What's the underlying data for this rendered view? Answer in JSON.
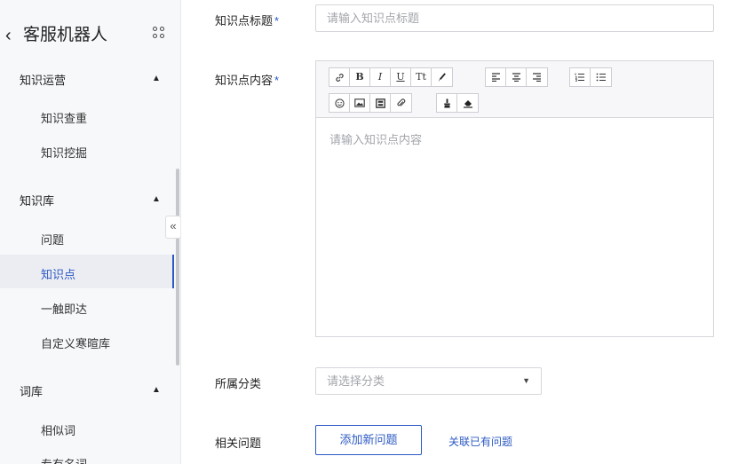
{
  "sidebar": {
    "title": "客服机器人",
    "sections": [
      {
        "label": "知识运营",
        "items": [
          "知识查重",
          "知识挖掘"
        ]
      },
      {
        "label": "知识库",
        "items": [
          "问题",
          "知识点",
          "一触即达",
          "自定义寒暄库"
        ]
      },
      {
        "label": "词库",
        "items": [
          "相似词",
          "专有名词"
        ]
      }
    ],
    "active_item": "知识点",
    "collapse_glyph": "«"
  },
  "form": {
    "title_label": "知识点标题",
    "title_placeholder": "请输入知识点标题",
    "content_label": "知识点内容",
    "content_placeholder": "请输入知识点内容",
    "required_mark": "*",
    "category_label": "所属分类",
    "category_placeholder": "请选择分类",
    "related_label": "相关问题",
    "add_question_button": "添加新问题",
    "link_existing": "关联已有问题"
  },
  "toolbar": {
    "bold": "B",
    "italic": "I",
    "underline": "U",
    "font_size": "Tt"
  },
  "icons": [
    "back-icon",
    "apps-icon",
    "link-icon",
    "bold-icon",
    "italic-icon",
    "underline-icon",
    "font-size-icon",
    "brush-icon",
    "align-left-icon",
    "align-center-icon",
    "align-right-icon",
    "ordered-list-icon",
    "unordered-list-icon",
    "emoji-icon",
    "image-icon",
    "video-icon",
    "attachment-icon",
    "format-painter-icon",
    "eraser-icon",
    "chevron-up-icon",
    "chevron-down-icon"
  ],
  "colors": {
    "accent": "#2b59c3",
    "sidebar_bg": "#f7f8fa",
    "border": "#d6d7db"
  }
}
